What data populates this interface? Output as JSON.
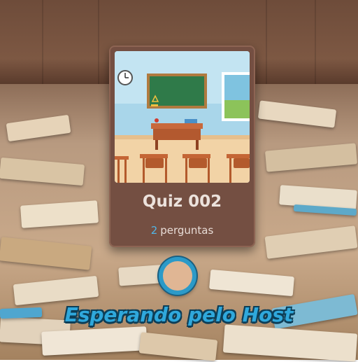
{
  "quiz_card": {
    "title": "Quiz 002",
    "question_count": "2",
    "question_label": "perguntas"
  },
  "status": {
    "message": "Esperando pelo Host"
  },
  "colors": {
    "card_bg": "#744f42",
    "accent_blue": "#2fa8dc",
    "count_blue": "#52b6e6"
  },
  "icons": {
    "card_image": "classroom-illustration",
    "loading": "loading-spinner-icon"
  }
}
